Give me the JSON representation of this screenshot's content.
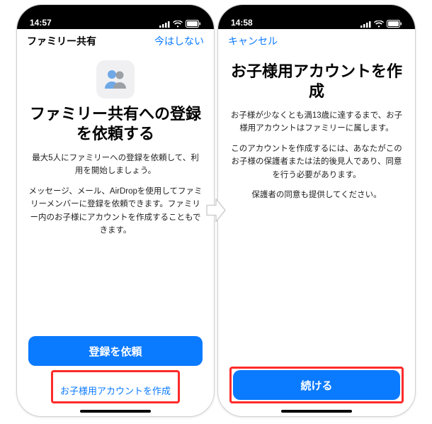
{
  "colors": {
    "accent": "#0a7aff",
    "highlight": "#ff2a2a"
  },
  "left": {
    "status_time": "14:57",
    "nav_title": "ファミリー共有",
    "nav_right": "今はしない",
    "icon_name": "family-silhouette-icon",
    "heading": "ファミリー共有への登録を依頼する",
    "para1": "最大5人にファミリーへの登録を依頼して、利用を開始しましょう。",
    "para2": "メッセージ、メール、AirDropを使用してファミリーメンバーに登録を依頼できます。ファミリー内のお子様にアカウントを作成することもできます。",
    "primary_btn": "登録を依頼",
    "secondary_btn": "お子様用アカウントを作成"
  },
  "right": {
    "status_time": "14:58",
    "nav_left": "キャンセル",
    "heading": "お子様用アカウントを作成",
    "para1": "お子様が少なくとも満13歳に達するまで、お子様用アカウントはファミリーに属します。",
    "para2": "このアカウントを作成するには、あなたがこのお子様の保護者または法的後見人であり、同意を行う必要があります。",
    "para3": "保護者の同意も提供してください。",
    "primary_btn": "続ける"
  }
}
